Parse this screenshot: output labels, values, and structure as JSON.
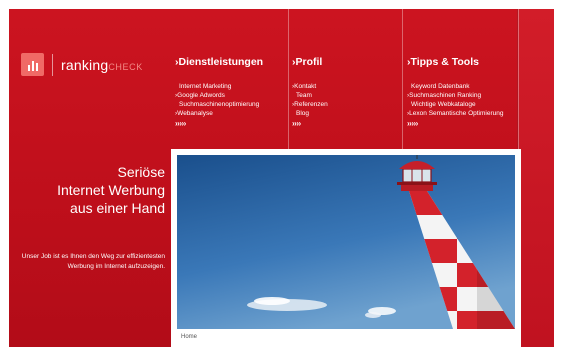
{
  "logo": {
    "name_main": "ranking",
    "name_accent": "CHECK"
  },
  "nav": [
    {
      "title": "Dienstleistungen",
      "items": [
        "Internet Marketing",
        "Google Adwords",
        "Suchmaschinenoptimierung",
        "Webanalyse"
      ],
      "more": "›››››"
    },
    {
      "title": "Profil",
      "items": [
        "Kontakt",
        "Team",
        "Referenzen",
        "Blog"
      ],
      "more": "››››"
    },
    {
      "title": "Tipps & Tools",
      "items": [
        "Keyword Datenbank",
        "Suchmaschinen Ranking",
        "Wichtige Webkataloge",
        "Lexon Semantische Optimierung"
      ],
      "more": "›››››"
    }
  ],
  "tagline": {
    "line1": "Seriöse",
    "line2": "Internet Werbung",
    "line3": "aus einer Hand"
  },
  "description": "Unser Job ist es Ihnen den Weg zur effizientesten Werbung im Internet aufzuzeigen.",
  "breadcrumb": "Home",
  "colors": {
    "brand_red": "#c4121d",
    "logo_accent": "#f06a66"
  }
}
